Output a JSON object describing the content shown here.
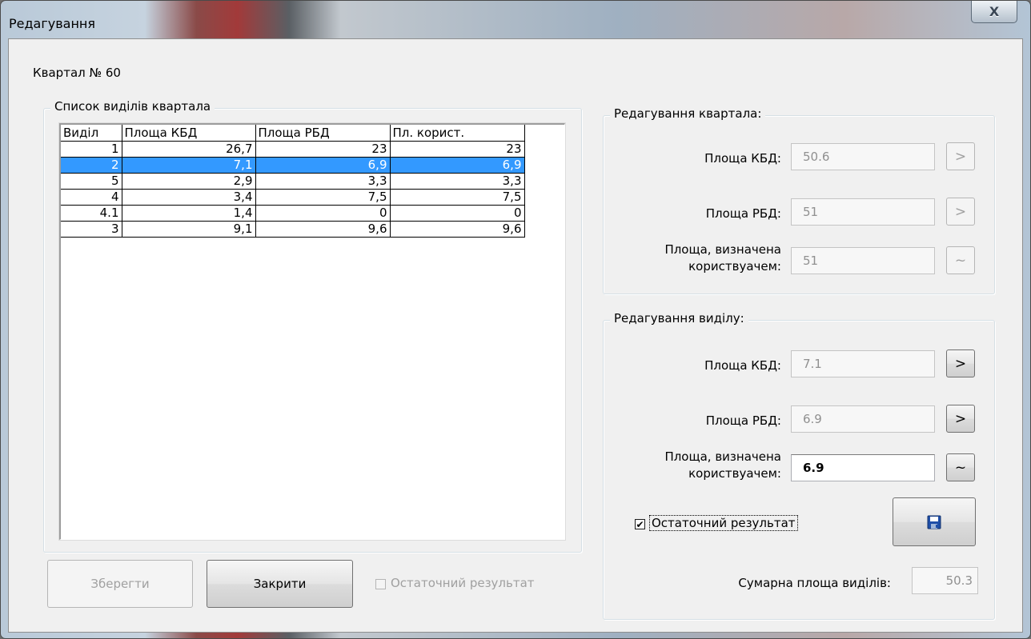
{
  "window": {
    "title": "Редагування",
    "close_icon": "X"
  },
  "quarter_label": "Квартал № 60",
  "list_group": {
    "title": "Список виділів квартала",
    "columns": [
      "Виділ",
      "Площа КБД",
      "Площа РБД",
      "Пл. корист."
    ],
    "rows": [
      [
        "1",
        "26,7",
        "23",
        "23"
      ],
      [
        "2",
        "7,1",
        "6,9",
        "6,9"
      ],
      [
        "5",
        "2,9",
        "3,3",
        "3,3"
      ],
      [
        "4",
        "3,4",
        "7,5",
        "7,5"
      ],
      [
        "4.1",
        "1,4",
        "0",
        "0"
      ],
      [
        "3",
        "9,1",
        "9,6",
        "9,6"
      ]
    ],
    "selected_row": 1
  },
  "footer": {
    "save_label": "Зберегти",
    "close_label": "Закрити",
    "final_result_label": "Остаточний результат"
  },
  "quarter_group": {
    "title": "Редагування квартала:",
    "kbd_label": "Площа КБД:",
    "kbd_value": "50.6",
    "rbd_label": "Площа РБД:",
    "rbd_value": "51",
    "user_label_line1": "Площа, визначена",
    "user_label_line2": "користвуачем:",
    "user_value": "51",
    "arrow_label": ">",
    "tilde_label": "~"
  },
  "section_group": {
    "title": "Редагування виділу:",
    "kbd_label": "Площа КБД:",
    "kbd_value": "7.1",
    "rbd_label": "Площа РБД:",
    "rbd_value": "6.9",
    "user_label_line1": "Площа, визначена",
    "user_label_line2": "користвуачем:",
    "user_value": "6.9",
    "arrow_label": ">",
    "tilde_label": "~",
    "final_result_label": "Остаточний результат",
    "final_result_checked": true,
    "check_mark": "✔",
    "sum_label": "Сумарна площа виділів:",
    "sum_value": "50.3"
  },
  "colors": {
    "selection": "#3399ff",
    "client_bg": "#f0f0f0"
  },
  "icons": {
    "save": "floppy-disk-icon",
    "close": "close-icon"
  }
}
